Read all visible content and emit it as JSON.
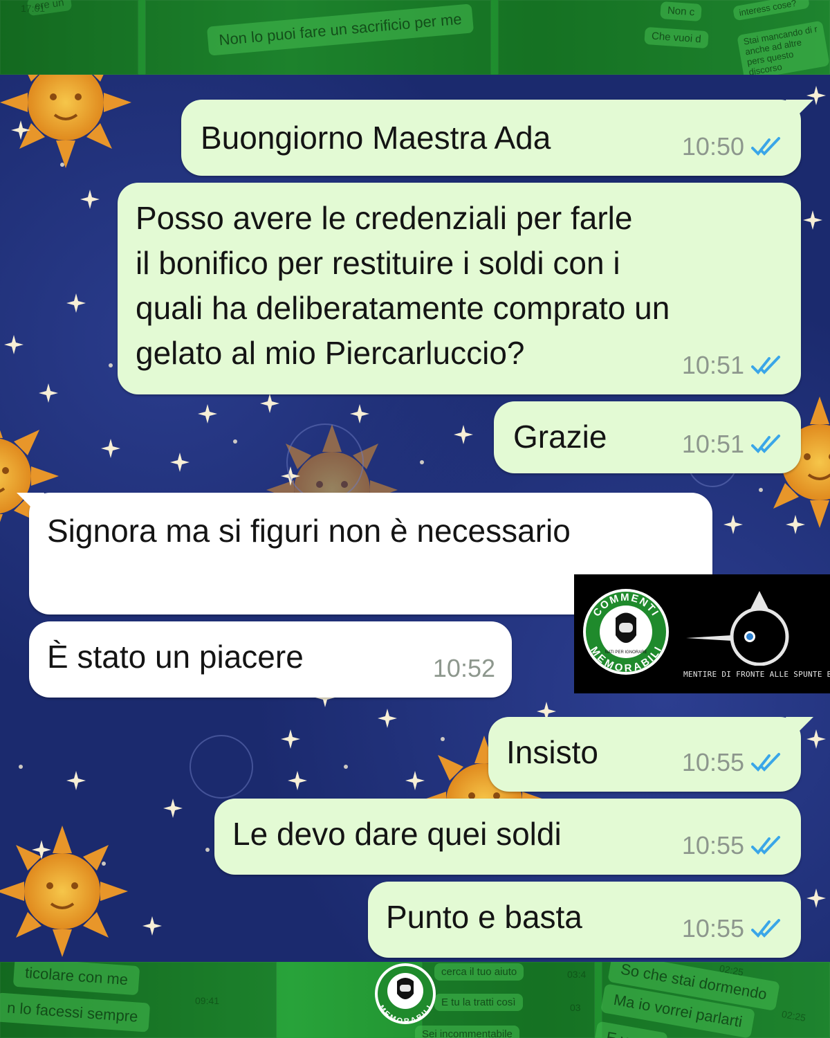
{
  "frame": {
    "top_snippets": {
      "left_faded": "ere un",
      "left_time": "17:01",
      "center": "Non lo puoi fare un sacrificio per me",
      "right_1": "Non c",
      "right_2": "Che vuoi d",
      "right_3": "interess cose?",
      "right_4": "Stai mancando di r anche ad altre pers questo discorso"
    },
    "bottom_snippets": {
      "left_1": "ticolare con me",
      "left_2": "n lo facessi sempre",
      "left_time": "09:41",
      "center_1": "cerca il tuo aiuto",
      "center_1_time": "03:4",
      "center_2": "E tu la tratti così",
      "center_2_time": "03",
      "center_3": "Sei incommentabile",
      "right_1": "So che stai dormendo",
      "right_1_time": "02:25",
      "right_2": "Ma io vorrei parlarti",
      "right_2_time": "02:25",
      "right_3": "E vorre"
    }
  },
  "messages": [
    {
      "id": "m1",
      "direction": "out",
      "lines": [
        "Buongiorno Maestra Ada"
      ],
      "time": "10:50",
      "ticks": "read"
    },
    {
      "id": "m2",
      "direction": "out",
      "lines": [
        "Posso avere le credenziali per farle",
        "il bonifico per restituire i soldi con i",
        "quali ha deliberatamente comprato un",
        "gelato al mio Piercarluccio?"
      ],
      "time": "10:51",
      "ticks": "read"
    },
    {
      "id": "m3",
      "direction": "out",
      "lines": [
        "Grazie"
      ],
      "time": "10:51",
      "ticks": "read"
    },
    {
      "id": "m4",
      "direction": "in",
      "lines": [
        "Signora ma si figuri non è necessario"
      ],
      "time": "",
      "ticks": ""
    },
    {
      "id": "m5",
      "direction": "in",
      "lines": [
        "È stato un piacere"
      ],
      "time": "10:52",
      "ticks": ""
    },
    {
      "id": "m6",
      "direction": "out",
      "lines": [
        "Insisto"
      ],
      "time": "10:55",
      "ticks": "read"
    },
    {
      "id": "m7",
      "direction": "out",
      "lines": [
        "Le devo dare quei soldi"
      ],
      "time": "10:55",
      "ticks": "read"
    },
    {
      "id": "m8",
      "direction": "out",
      "lines": [
        "Punto e basta"
      ],
      "time": "10:55",
      "ticks": "read"
    }
  ],
  "logo": {
    "ring_top": "COMMENTI",
    "ring_bottom": "MEMORABILI",
    "badge_inner": "NATI PER IGNORARE",
    "caption": "MENTIRE DI FRONTE ALLE SPUNTE BLU"
  },
  "colors": {
    "outgoing_bubble": "#e3fad4",
    "incoming_bubble": "#ffffff",
    "read_ticks": "#3aa6e8",
    "frame_green": "#1f8a2c",
    "sky_blue": "#1b2a6e"
  }
}
